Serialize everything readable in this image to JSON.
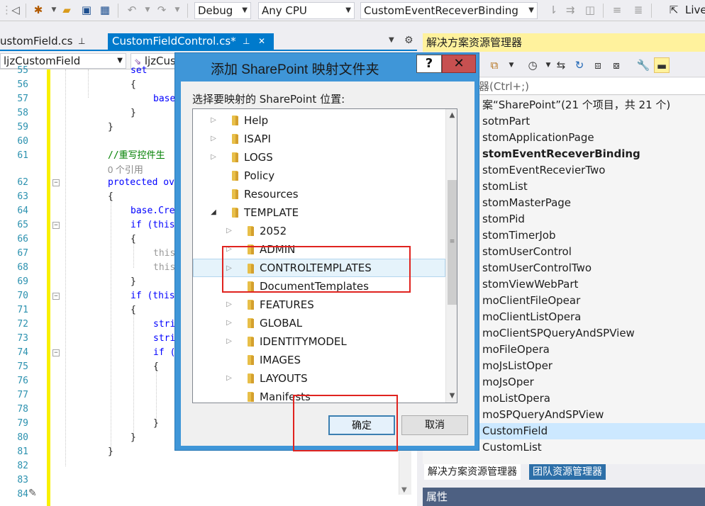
{
  "toolbar": {
    "config": "Debug",
    "platform": "Any CPU",
    "startup_item": "CustomEventReceverBinding",
    "live_share": "Live"
  },
  "tabs": [
    {
      "label": "ustomField.cs",
      "pin": "⊥",
      "active": false
    },
    {
      "label": "CustomFieldControl.cs*",
      "pin": "⊥",
      "close": "✕",
      "active": true
    }
  ],
  "nav": {
    "class_combo": "ljzCustomField",
    "member_combo": "ljzCus"
  },
  "editor": {
    "lines": [
      {
        "n": "55",
        "code": "set"
      },
      {
        "n": "56",
        "code": "{"
      },
      {
        "n": "57",
        "code": "base"
      },
      {
        "n": "58",
        "code": "}"
      },
      {
        "n": "59",
        "code": "}"
      },
      {
        "n": "60",
        "code": ""
      },
      {
        "n": "61",
        "code": "//重写控件生"
      },
      {
        "n": "",
        "code": "0 个引用"
      },
      {
        "n": "62",
        "code": "protected ov"
      },
      {
        "n": "63",
        "code": "{"
      },
      {
        "n": "64",
        "code": "base.Cre"
      },
      {
        "n": "65",
        "code": "if (this"
      },
      {
        "n": "66",
        "code": "{"
      },
      {
        "n": "67",
        "code": "this"
      },
      {
        "n": "68",
        "code": "this"
      },
      {
        "n": "69",
        "code": "}"
      },
      {
        "n": "70",
        "code": "if (this"
      },
      {
        "n": "71",
        "code": "{"
      },
      {
        "n": "72",
        "code": "stri"
      },
      {
        "n": "73",
        "code": "stri"
      },
      {
        "n": "74",
        "code": "if ("
      },
      {
        "n": "75",
        "code": "{"
      },
      {
        "n": "76",
        "code": ""
      },
      {
        "n": "77",
        "code": ""
      },
      {
        "n": "78",
        "code": ""
      },
      {
        "n": "79",
        "code": "}"
      },
      {
        "n": "80",
        "code": "}"
      },
      {
        "n": "81",
        "code": "}"
      },
      {
        "n": "82",
        "code": ""
      },
      {
        "n": "83",
        "code": ""
      },
      {
        "n": "84",
        "code": ""
      }
    ]
  },
  "solution_explorer": {
    "title": "解决方案资源管理器",
    "search_placeholder": "案资源管理器(Ctrl+;)",
    "items": [
      {
        "label": "案“SharePoint”(21 个项目，共 21 个)"
      },
      {
        "label": "sotmPart"
      },
      {
        "label": "stomApplicationPage"
      },
      {
        "label": "stomEventReceverBinding",
        "bold": true
      },
      {
        "label": "stomEventRecevierTwo"
      },
      {
        "label": "stomList"
      },
      {
        "label": "stomMasterPage"
      },
      {
        "label": "stomPid"
      },
      {
        "label": "stomTimerJob"
      },
      {
        "label": "stomUserControl"
      },
      {
        "label": "stomUserControlTwo"
      },
      {
        "label": "stomViewWebPart"
      },
      {
        "label": "moClientFileOpear"
      },
      {
        "label": "moClientListOpera"
      },
      {
        "label": "moClientSPQueryAndSPView"
      },
      {
        "label": "moFileOpera"
      },
      {
        "label": "moJsListOper"
      },
      {
        "label": "moJsOper"
      },
      {
        "label": "moListOpera"
      },
      {
        "label": "moSPQueryAndSPView"
      },
      {
        "label": "CustomField",
        "selected": true
      },
      {
        "label": "CustomList"
      }
    ],
    "bottom_tabs": [
      "解决方案资源管理器",
      "团队资源管理器"
    ],
    "properties_title": "属性"
  },
  "dialog": {
    "title": "添加 SharePoint 映射文件夹",
    "help_label": "?",
    "close_label": "✕",
    "prompt": "选择要映射的 SharePoint 位置:",
    "tree": [
      {
        "label": "Help",
        "level": 0,
        "expander": "▷"
      },
      {
        "label": "ISAPI",
        "level": 0,
        "expander": "▷"
      },
      {
        "label": "LOGS",
        "level": 0,
        "expander": "▷"
      },
      {
        "label": "Policy",
        "level": 0,
        "expander": ""
      },
      {
        "label": "Resources",
        "level": 0,
        "expander": ""
      },
      {
        "label": "TEMPLATE",
        "level": 0,
        "expander": "◢"
      },
      {
        "label": "2052",
        "level": 1,
        "expander": "▷"
      },
      {
        "label": "ADMIN",
        "level": 1,
        "expander": "▷"
      },
      {
        "label": "CONTROLTEMPLATES",
        "level": 1,
        "expander": "▷",
        "highlighted": true
      },
      {
        "label": "DocumentTemplates",
        "level": 1,
        "expander": ""
      },
      {
        "label": "FEATURES",
        "level": 1,
        "expander": "▷"
      },
      {
        "label": "GLOBAL",
        "level": 1,
        "expander": "▷"
      },
      {
        "label": "IDENTITYMODEL",
        "level": 1,
        "expander": "▷"
      },
      {
        "label": "IMAGES",
        "level": 1,
        "expander": ""
      },
      {
        "label": "LAYOUTS",
        "level": 1,
        "expander": "▷"
      },
      {
        "label": "Manifests",
        "level": 1,
        "expander": ""
      }
    ],
    "ok_label": "确定",
    "cancel_label": "取消"
  }
}
